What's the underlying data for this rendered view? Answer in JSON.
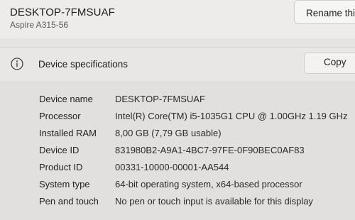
{
  "header": {
    "pc_name": "DESKTOP-7FMSUAF",
    "model": "Aspire A315-56",
    "rename_label": "Rename this"
  },
  "specs": {
    "title": "Device specifications",
    "copy_label": "Copy",
    "icon": "info-icon",
    "rows": [
      {
        "label": "Device name",
        "value": "DESKTOP-7FMSUAF"
      },
      {
        "label": "Processor",
        "value": "Intel(R) Core(TM) i5-1035G1 CPU @ 1.00GHz   1.19 GHz"
      },
      {
        "label": "Installed RAM",
        "value": "8,00 GB (7,79 GB usable)"
      },
      {
        "label": "Device ID",
        "value": "831980B2-A9A1-4BC7-97FE-0F90BEC0AF83"
      },
      {
        "label": "Product ID",
        "value": "00331-10000-00001-AA544"
      },
      {
        "label": "System type",
        "value": "64-bit operating system, x64-based processor"
      },
      {
        "label": "Pen and touch",
        "value": "No pen or touch input is available for this display"
      }
    ]
  }
}
